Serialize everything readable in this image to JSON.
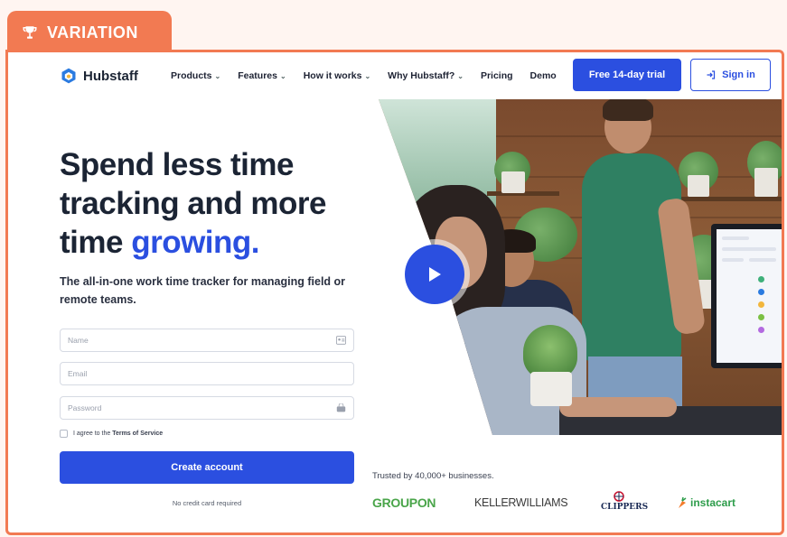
{
  "badge": {
    "label": "VARIATION",
    "icon": "trophy-icon",
    "color": "#f27a52"
  },
  "nav": {
    "brand": "Hubstaff",
    "items": [
      {
        "label": "Products",
        "dropdown": true
      },
      {
        "label": "Features",
        "dropdown": true
      },
      {
        "label": "How it works",
        "dropdown": true
      },
      {
        "label": "Why Hubstaff?",
        "dropdown": true
      },
      {
        "label": "Pricing",
        "dropdown": false
      },
      {
        "label": "Demo",
        "dropdown": false
      }
    ],
    "trial_label": "Free 14-day trial",
    "signin_label": "Sign in",
    "accent": "#2b4fe0"
  },
  "hero": {
    "line1": "Spend less time",
    "line2": "tracking and more",
    "line3_prefix": "time ",
    "line3_accent": "growing.",
    "subhead": "The all-in-one work time tracker for managing field or remote teams."
  },
  "form": {
    "name_placeholder": "Name",
    "email_placeholder": "Email",
    "password_placeholder": "Password",
    "terms_prefix": "I agree to the ",
    "terms_link": "Terms of Service",
    "submit_label": "Create account",
    "note": "No credit card required"
  },
  "trust": {
    "caption": "Trusted by 40,000+ businesses.",
    "logos": [
      "GROUPON",
      "KELLERWILLIAMS",
      "CLIPPERS",
      "instacart"
    ]
  }
}
